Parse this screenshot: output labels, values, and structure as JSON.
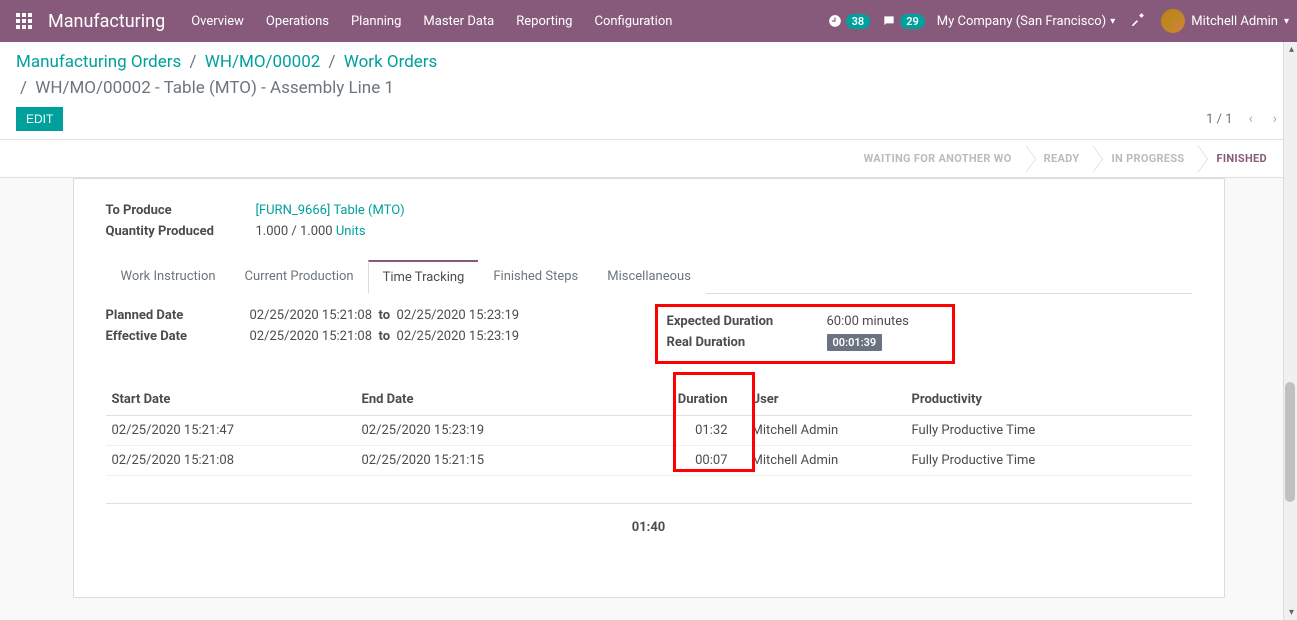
{
  "topbar": {
    "title": "Manufacturing",
    "menu": [
      "Overview",
      "Operations",
      "Planning",
      "Master Data",
      "Reporting",
      "Configuration"
    ],
    "badge1": "38",
    "badge2": "29",
    "company": "My Company (San Francisco)",
    "user": "Mitchell Admin"
  },
  "breadcrumb": {
    "items": [
      "Manufacturing Orders",
      "WH/MO/00002",
      "Work Orders"
    ],
    "current": "WH/MO/00002 - Table (MTO) - Assembly Line 1",
    "edit": "EDIT",
    "pager": "1 / 1"
  },
  "status": {
    "steps": [
      "WAITING FOR ANOTHER WO",
      "READY",
      "IN PROGRESS",
      "FINISHED"
    ],
    "active_index": 3
  },
  "summary": {
    "to_produce_label": "To Produce",
    "to_produce_value": "[FURN_9666] Table (MTO)",
    "qty_label": "Quantity Produced",
    "qty_value": "1.000  /  1.000",
    "qty_unit": "Units"
  },
  "tabs": [
    "Work Instruction",
    "Current Production",
    "Time Tracking",
    "Finished Steps",
    "Miscellaneous"
  ],
  "active_tab": 2,
  "left_dates": {
    "planned_label": "Planned Date",
    "planned_from": "02/25/2020 15:21:08",
    "planned_to_word": "to",
    "planned_to": "02/25/2020 15:23:19",
    "effective_label": "Effective Date",
    "effective_from": "02/25/2020 15:21:08",
    "effective_to_word": "to",
    "effective_to": "02/25/2020 15:23:19"
  },
  "right_dur": {
    "expected_label": "Expected Duration",
    "expected_value": "60:00 minutes",
    "real_label": "Real Duration",
    "real_value": "00:01:39"
  },
  "table": {
    "headers": {
      "start": "Start Date",
      "end": "End Date",
      "duration": "Duration",
      "user": "User",
      "productivity": "Productivity"
    },
    "rows": [
      {
        "start": "02/25/2020 15:21:47",
        "end": "02/25/2020 15:23:19",
        "duration": "01:32",
        "user": "Mitchell Admin",
        "productivity": "Fully Productive Time"
      },
      {
        "start": "02/25/2020 15:21:08",
        "end": "02/25/2020 15:21:15",
        "duration": "00:07",
        "user": "Mitchell Admin",
        "productivity": "Fully Productive Time"
      }
    ],
    "footer_total": "01:40"
  }
}
